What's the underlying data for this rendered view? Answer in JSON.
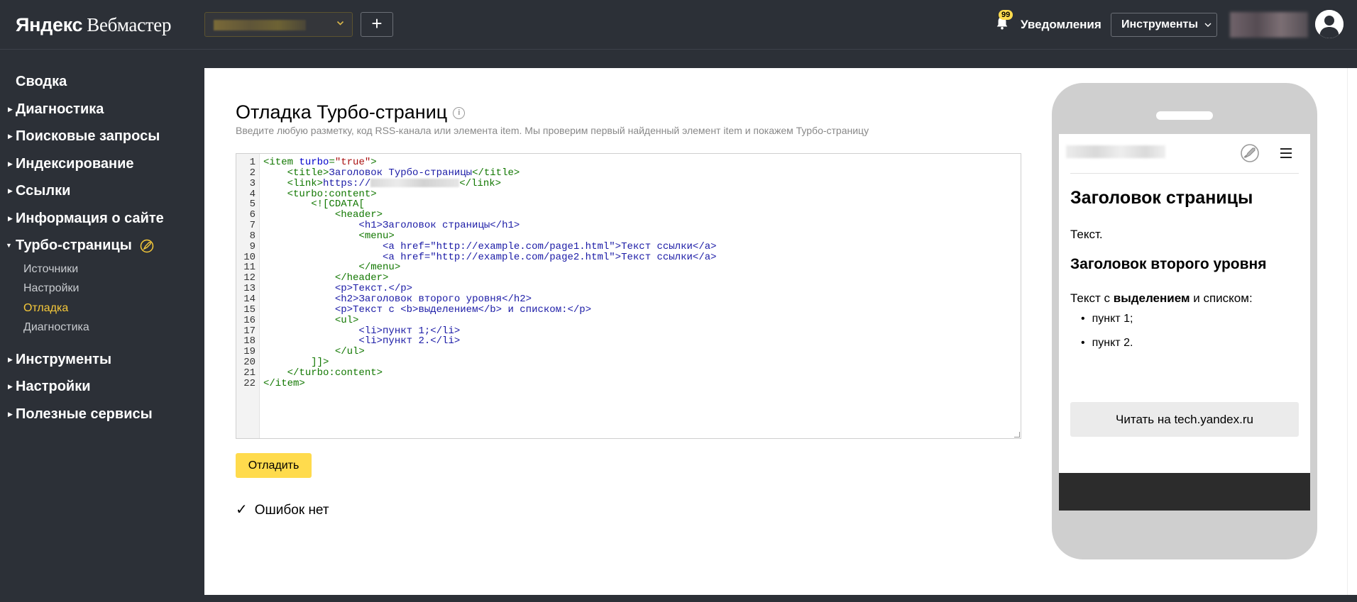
{
  "header": {
    "logo_brand": "Яндекс",
    "logo_product": "Вебмастер",
    "add_button": "+",
    "notifications": {
      "label": "Уведомления",
      "badge": "99"
    },
    "tools_button": "Инструменты"
  },
  "sidebar": {
    "items": [
      {
        "label": "Сводка"
      },
      {
        "label": "Диагностика"
      },
      {
        "label": "Поисковые запросы"
      },
      {
        "label": "Индексирование"
      },
      {
        "label": "Ссылки"
      },
      {
        "label": "Информация о сайте"
      },
      {
        "label": "Турбо-страницы"
      },
      {
        "label": "Инструменты"
      },
      {
        "label": "Настройки"
      },
      {
        "label": "Полезные сервисы"
      }
    ],
    "turbo_sub": [
      {
        "label": "Источники"
      },
      {
        "label": "Настройки"
      },
      {
        "label": "Отладка"
      },
      {
        "label": "Диагностика"
      }
    ]
  },
  "main": {
    "title": "Отладка Турбо-страниц",
    "description": "Введите любую разметку, код RSS-канала или элемента item. Мы проверим первый найденный элемент item и покажем Турбо-страницу",
    "debug_button": "Отладить",
    "status": "Ошибок нет"
  },
  "editor": {
    "line_numbers": [
      "1",
      "2",
      "3",
      "4",
      "5",
      "6",
      "7",
      "8",
      "9",
      "10",
      "11",
      "12",
      "13",
      "14",
      "15",
      "16",
      "17",
      "18",
      "19",
      "20",
      "21",
      "22"
    ],
    "l1": {
      "tag_open": "<item ",
      "attr": "turbo",
      "eq": "=",
      "val": "\"true\"",
      "close": ">"
    },
    "l2": {
      "indent": "    ",
      "open": "<title>",
      "text": "Заголовок Турбо-страницы",
      "close": "</title>"
    },
    "l3": {
      "indent": "    ",
      "open": "<link>",
      "text": "https://",
      "close": "</link>"
    },
    "l4": {
      "indent": "    ",
      "open": "<turbo:content>"
    },
    "l5": {
      "indent": "        ",
      "open": "<![CDATA["
    },
    "l6": {
      "indent": "            ",
      "open": "<header>"
    },
    "l7": {
      "indent": "                ",
      "open": "<h1>",
      "text": "Заголовок страницы",
      "close": "</h1>"
    },
    "l8": {
      "indent": "                ",
      "open": "<menu>"
    },
    "l9": {
      "indent": "                    ",
      "open": "<a href=\"http://example.com/page1.html\">",
      "text": "Текст ссылки",
      "close": "</a>"
    },
    "l10": {
      "indent": "                    ",
      "open": "<a href=\"http://example.com/page2.html\">",
      "text": "Текст ссылки",
      "close": "</a>"
    },
    "l11": {
      "indent": "                ",
      "open": "</menu>"
    },
    "l12": {
      "indent": "            ",
      "open": "</header>"
    },
    "l13": {
      "indent": "            ",
      "open": "<p>",
      "text": "Текст.",
      "close": "</p>"
    },
    "l14": {
      "indent": "            ",
      "open": "<h2>",
      "text": "Заголовок второго уровня",
      "close": "</h2>"
    },
    "l15": {
      "indent": "            ",
      "open": "<p>",
      "text": "Текст с <b>выделением</b> и списком:",
      "close": "</p>"
    },
    "l16": {
      "indent": "            ",
      "open": "<ul>"
    },
    "l17": {
      "indent": "                ",
      "open": "<li>",
      "text": "пункт 1;",
      "close": "</li>"
    },
    "l18": {
      "indent": "                ",
      "open": "<li>",
      "text": "пункт 2.",
      "close": "</li>"
    },
    "l19": {
      "indent": "            ",
      "open": "</ul>"
    },
    "l20": {
      "indent": "        ",
      "open": "]]>"
    },
    "l21": {
      "indent": "    ",
      "open": "</turbo:content>"
    },
    "l22": {
      "indent": "",
      "open": "</item>"
    }
  },
  "preview": {
    "h1": "Заголовок страницы",
    "p1": "Текст.",
    "h2": "Заголовок второго уровня",
    "p2_before": "Текст с ",
    "p2_bold": "выделением",
    "p2_after": " и списком:",
    "list": [
      "пункт 1;",
      "пункт 2."
    ],
    "bullet": "•",
    "read_button": "Читать на tech.yandex.ru"
  },
  "colors": {
    "accent_yellow": "#ffdb4d",
    "sidebar_bg": "#2c3037",
    "active_sub": "#f6c93a"
  },
  "icons": [
    "chevron-down-icon",
    "plus-icon",
    "bell-icon",
    "avatar-icon",
    "turbo-rocket-icon",
    "info-icon",
    "check-icon",
    "burger-menu-icon"
  ]
}
